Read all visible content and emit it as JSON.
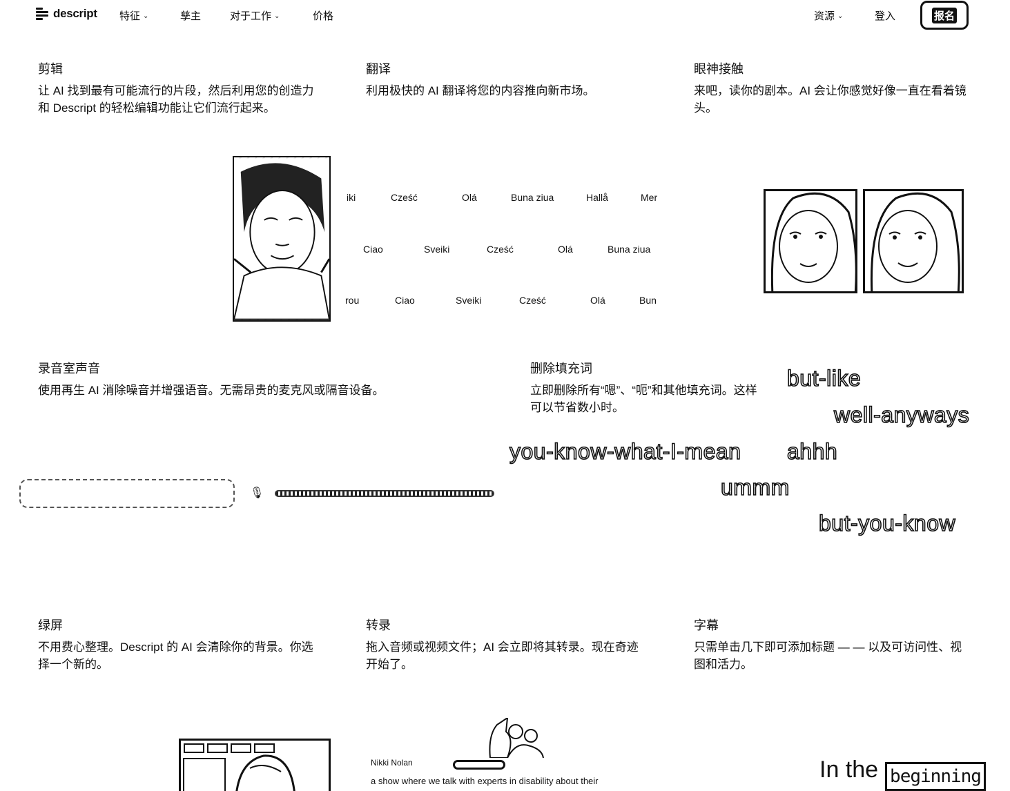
{
  "nav": {
    "logo_text": "descript",
    "items": [
      {
        "label": "特征",
        "has_menu": true
      },
      {
        "label": "孳主",
        "has_menu": false
      },
      {
        "label": "对于工作",
        "has_menu": true
      },
      {
        "label": "价格",
        "has_menu": false
      }
    ],
    "resources": {
      "label": "资源",
      "has_menu": true
    },
    "login": "登入",
    "signup": "报名"
  },
  "features": {
    "edit": {
      "title": "剪辑",
      "desc": "让 AI 找到最有可能流行的片段，然后利用您的创造力和 Descript 的轻松编辑功能让它们流行起来。"
    },
    "translate": {
      "title": "翻译",
      "desc": "利用极快的 AI 翻译将您的内容推向新市场。"
    },
    "eye": {
      "title": "眼神接触",
      "desc": "来吧，读你的剧本。AI 会让你感觉好像一直在看着镜头。"
    },
    "studio": {
      "title": "录音室声音",
      "desc": "使用再生 AI 消除噪音并增强语音。无需昂贵的麦克风或隔音设备。"
    },
    "filler": {
      "title": "删除填充词",
      "desc": "立即删除所有“嗯”、“呃”和其他填充词。这样可以节省数小时。"
    },
    "greenscreen": {
      "title": "绿屏",
      "desc": "不用费心整理。Descript 的 AI 会清除你的背景。你选择一个新的。"
    },
    "transcribe": {
      "title": "转录",
      "desc": "拖入音频或视频文件；AI 会立即将其转录。现在奇迹开始了。"
    },
    "captions": {
      "title": "字幕",
      "desc": "只需单击几下即可添加标题 — — 以及可访问性、视图和活力。"
    }
  },
  "translate_rows": [
    [
      "iki",
      "Cześć",
      "Olá",
      "Buna ziua",
      "Hallå",
      "Mer"
    ],
    [
      "Ciao",
      "Sveiki",
      "Cześć",
      "Olá",
      "Buna ziua"
    ],
    [
      "rou",
      "Ciao",
      "Sveiki",
      "Cześć",
      "Olá",
      "Bun"
    ]
  ],
  "filler_words": [
    "but-like",
    "well-anyways",
    "you-know-what-I-mean",
    "ahhh",
    "ummm",
    "but-you-know"
  ],
  "transcript": {
    "speaker": "Nikki Nolan",
    "line": "a show where we talk with experts in disability about their"
  },
  "caption_demo": {
    "prefix": "In the",
    "highlight": "beginning"
  }
}
